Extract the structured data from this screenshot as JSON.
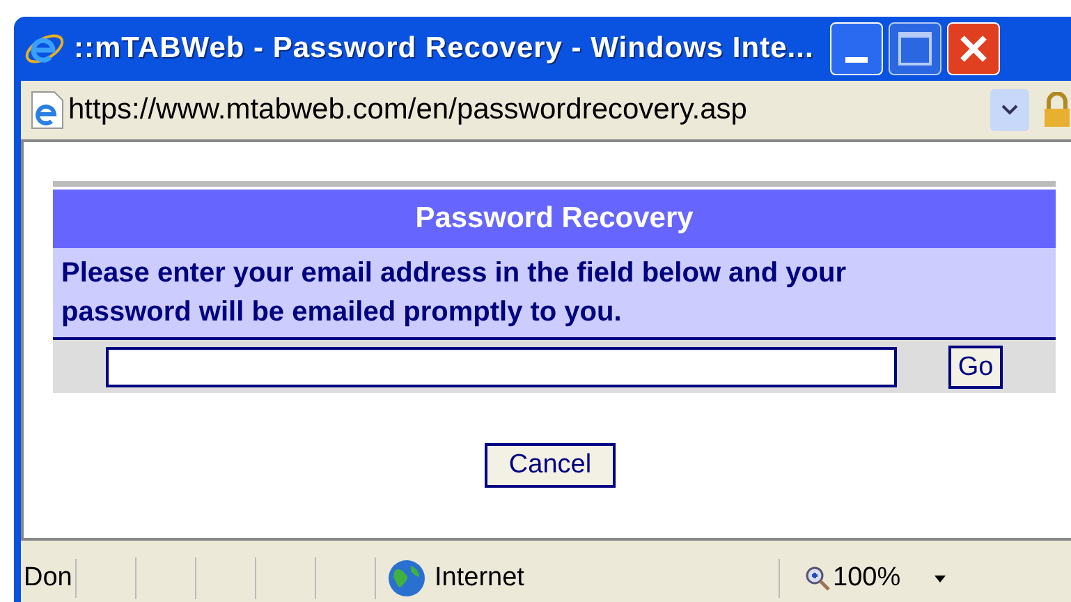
{
  "window": {
    "title": "::mTABWeb - Password Recovery - Windows Inte..."
  },
  "address_bar": {
    "url": "https://www.mtabweb.com/en/passwordrecovery.asp"
  },
  "form": {
    "heading": "Password Recovery",
    "instructions": "Please enter your email address in the field below and your password will be emailed promptly to you.",
    "go_button": "Go",
    "cancel_button": "Cancel"
  },
  "status_bar": {
    "status": "Don",
    "zone": "Internet",
    "zoom": "100%"
  }
}
